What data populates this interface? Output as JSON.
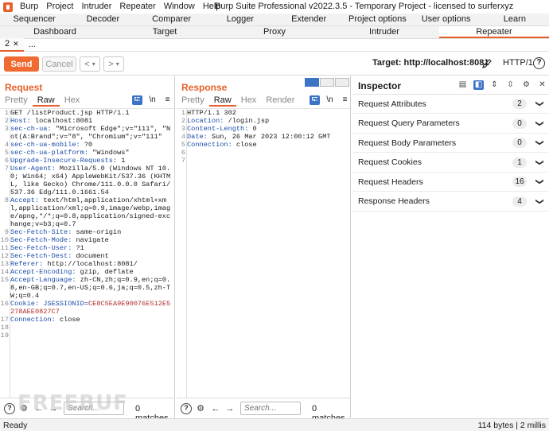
{
  "menu": [
    "Burp",
    "Project",
    "Intruder",
    "Repeater",
    "Window",
    "Help"
  ],
  "window_title": "Burp Suite Professional v2022.3.5 - Temporary Project - licensed to surferxyz",
  "tabs_row1": [
    "Sequencer",
    "Decoder",
    "Comparer",
    "Logger",
    "Extender",
    "Project options",
    "User options",
    "Learn"
  ],
  "tabs_row2": [
    "Dashboard",
    "Target",
    "Proxy",
    "Intruder",
    "Repeater"
  ],
  "sub_tabs": {
    "active": "2",
    "more": "..."
  },
  "toolbar": {
    "send": "Send",
    "cancel": "Cancel",
    "back": "<",
    "forward": ">",
    "dropdown": "▾",
    "target": "Target: http://localhost:8081",
    "http_version": "HTTP/1"
  },
  "request": {
    "title": "Request",
    "tabs": [
      "Pretty",
      "Raw",
      "Hex"
    ],
    "active_tab": "Raw",
    "lines": [
      {
        "n": "1",
        "text": "GET /listProduct.jsp HTTP/1.1"
      },
      {
        "n": "2",
        "key": "Host:",
        "val": " localhost:8081"
      },
      {
        "n": "3",
        "key": "sec-ch-ua:",
        "val": " \"Microsoft Edge\";v=\"111\", \"Not(A:Brand\";v=\"8\", \"Chromium\";v=\"111\""
      },
      {
        "n": "4",
        "key": "sec-ch-ua-mobile:",
        "val": " ?0"
      },
      {
        "n": "5",
        "key": "sec-ch-ua-platform:",
        "val": " \"Windows\""
      },
      {
        "n": "6",
        "key": "Upgrade-Insecure-Requests:",
        "val": " 1"
      },
      {
        "n": "7",
        "key": "User-Agent:",
        "val": " Mozilla/5.0 (Windows NT 10.0; Win64; x64) AppleWebKit/537.36 (KHTML, like Gecko) Chrome/111.0.0.0 Safari/537.36 Edg/111.0.1661.54"
      },
      {
        "n": "8",
        "key": "Accept:",
        "val": " text/html,application/xhtml+xml,application/xml;q=0.9,image/webp,image/apng,*/*;q=0.8,application/signed-exchange;v=b3;q=0.7"
      },
      {
        "n": "9",
        "key": "Sec-Fetch-Site:",
        "val": " same-origin"
      },
      {
        "n": "10",
        "key": "Sec-Fetch-Mode:",
        "val": " navigate"
      },
      {
        "n": "11",
        "key": "Sec-Fetch-User:",
        "val": " ?1"
      },
      {
        "n": "12",
        "key": "Sec-Fetch-Dest:",
        "val": " document"
      },
      {
        "n": "13",
        "key": "Referer:",
        "val": " http://localhost:8081/"
      },
      {
        "n": "14",
        "key": "Accept-Encoding:",
        "val": " gzip, deflate"
      },
      {
        "n": "15",
        "key": "Accept-Language:",
        "val": " zh-CN,zh;q=0.9,en;q=0.8,en-GB;q=0.7,en-US;q=0.6,ja;q=0.5,zh-TW;q=0.4"
      },
      {
        "n": "16",
        "key": "Cookie:",
        "val": " JSESSIONID=",
        "cookie": "CE8C5EA9E90076E512E5278AEE0827C7"
      },
      {
        "n": "17",
        "key": "Connection:",
        "val": " close"
      },
      {
        "n": "18",
        "text": ""
      },
      {
        "n": "19",
        "text": ""
      }
    ],
    "search_placeholder": "Search...",
    "matches": "0 matches"
  },
  "response": {
    "title": "Response",
    "tabs": [
      "Pretty",
      "Raw",
      "Hex",
      "Render"
    ],
    "active_tab": "Raw",
    "lines": [
      {
        "n": "1",
        "text": "HTTP/1.1 302"
      },
      {
        "n": "2",
        "key": "Location:",
        "val": " /login.jsp"
      },
      {
        "n": "3",
        "key": "Content-Length:",
        "val": " 0"
      },
      {
        "n": "4",
        "key": "Date:",
        "val": " Sun, 26 Mar 2023 12:00:12 GMT"
      },
      {
        "n": "5",
        "key": "Connection:",
        "val": " close"
      },
      {
        "n": "6",
        "text": ""
      },
      {
        "n": "7",
        "text": ""
      }
    ],
    "search_placeholder": "Search...",
    "matches": "0 matches"
  },
  "inspector": {
    "title": "Inspector",
    "sections": [
      {
        "label": "Request Attributes",
        "count": "2"
      },
      {
        "label": "Request Query Parameters",
        "count": "0"
      },
      {
        "label": "Request Body Parameters",
        "count": "0"
      },
      {
        "label": "Request Cookies",
        "count": "1"
      },
      {
        "label": "Request Headers",
        "count": "16"
      },
      {
        "label": "Response Headers",
        "count": "4"
      }
    ]
  },
  "status": {
    "left": "Ready",
    "right": "114 bytes | 2 millis"
  },
  "watermark": "FREEBUF",
  "colors": {
    "accent": "#e8602c",
    "send": "#ef6b31",
    "toggle": "#3b73c5",
    "header_key": "#1c4da8",
    "cookie": "#b02a2a"
  }
}
